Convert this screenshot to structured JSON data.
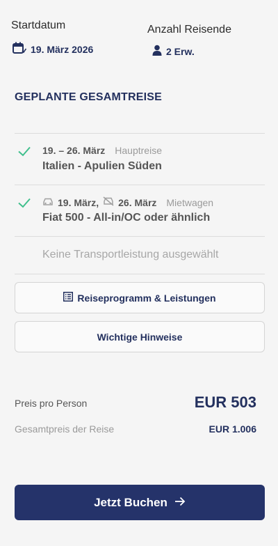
{
  "header": {
    "start_label": "Startdatum",
    "start_value": "19. März 2026",
    "travelers_label": "Anzahl Reisende",
    "travelers_value": "2 Erw."
  },
  "summary": {
    "title": "GEPLANTE GESAMTREISE",
    "items": [
      {
        "dates": "19. – 26. März",
        "type": "Hauptreise",
        "name": "Italien - Apulien Süden",
        "checked": true,
        "icons": [
          "check-icon"
        ]
      },
      {
        "date_from": "19. März,",
        "date_to": "26. März",
        "type": "Mietwagen",
        "name": "Fiat 500 - All-in/OC oder ähnlich",
        "checked": true,
        "icons": [
          "check-icon",
          "car-icon",
          "car-return-icon"
        ]
      }
    ],
    "no_transport": "Keine Transportleistung ausgewählt"
  },
  "buttons": {
    "program": "Reiseprogramm & Leistungen",
    "notes": "Wichtige Hinweise",
    "book": "Jetzt Buchen"
  },
  "pricing": {
    "per_person_label": "Preis pro Person",
    "per_person_value": "EUR 503",
    "total_label": "Gesamtpreis der Reise",
    "total_value": "EUR 1.006"
  },
  "colors": {
    "accent": "#25336a",
    "check": "#3fbf8c",
    "background": "#f5f5f5"
  }
}
